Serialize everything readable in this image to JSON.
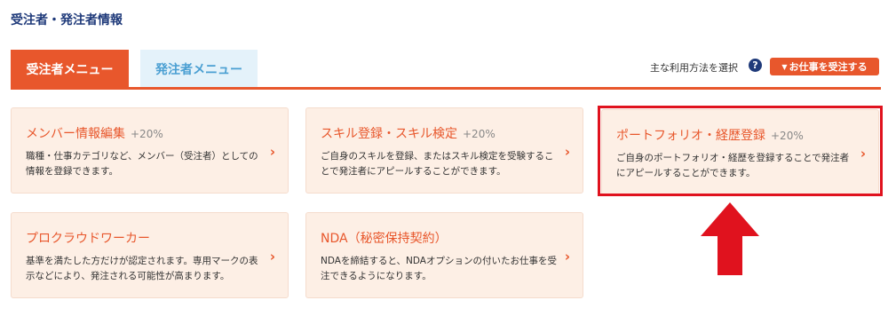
{
  "page": {
    "title": "受注者・発注者情報"
  },
  "tabs": [
    {
      "label": "受注者メニュー",
      "active": true
    },
    {
      "label": "発注者メニュー",
      "active": false
    }
  ],
  "toolbar": {
    "usage_label": "主な利用方法を選択",
    "help_icon": "?",
    "receive_button": "お仕事を受注する"
  },
  "cards": [
    {
      "title": "メンバー情報編集",
      "percent": "+20%",
      "description": "職種・仕事カテゴリなど、メンバー（受注者）としての情報を登録できます。"
    },
    {
      "title": "スキル登録・スキル検定",
      "percent": "+20%",
      "description": "ご自身のスキルを登録、またはスキル検定を受験することで発注者にアピールすることができます。"
    },
    {
      "title": "ポートフォリオ・経歴登録",
      "percent": "+20%",
      "description": "ご自身のポートフォリオ・経歴を登録することで発注者にアピールすることができます。"
    },
    {
      "title": "プロクラウドワーカー",
      "percent": "",
      "description": "基準を満たした方だけが認定されます。専用マークの表示などにより、発注される可能性が高まります。"
    },
    {
      "title": "NDA（秘密保持契約）",
      "percent": "",
      "description": "NDAを締結すると、NDAオプションの付いたお仕事を受注できるようになります。"
    }
  ],
  "colors": {
    "accent": "#e8572c",
    "navy": "#1f3a7a",
    "card_bg": "#fdefe5",
    "highlight": "#e0121e",
    "tab_inactive_bg": "#e4f2fa"
  }
}
